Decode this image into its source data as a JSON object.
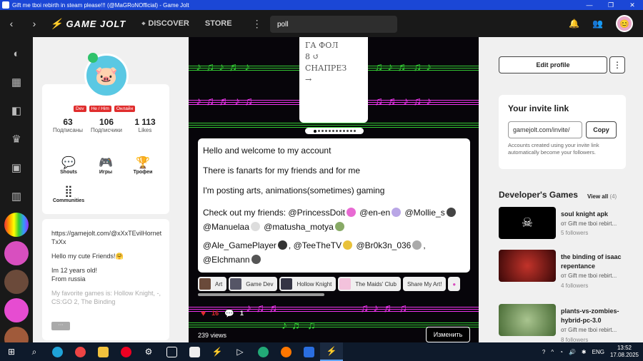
{
  "window": {
    "title": "Gift me tboi rebirth in steam please!!! (@MaGRoNOfficial) - Game Jolt",
    "minimize": "—",
    "maximize": "❐",
    "close": "✕"
  },
  "nav": {
    "back": "‹",
    "forward": "›",
    "logo": "GAME JOLT",
    "discover": "DISCOVER",
    "store": "STORE",
    "more": "⋮",
    "search_value": "poll"
  },
  "profile": {
    "tags": [
      "Dev",
      "He / Him",
      "Онлайн"
    ],
    "stats": [
      {
        "num": "63",
        "label": "Подписаны"
      },
      {
        "num": "106",
        "label": "Подписчики"
      },
      {
        "num": "1 113",
        "label": "Likes"
      }
    ],
    "tabs": [
      "Shouts",
      "Игры",
      "Трофеи",
      "Communities"
    ],
    "bio": {
      "link": "https://gamejolt.com/@xXxTEvilHornetTxXx",
      "greeting": "Hello my cute Friends!🤗",
      "age": "Im 12 years old!",
      "from": "From russia",
      "fav": "My favorite games is: Hollow Knight, -, CS:GO 2, The Binding",
      "more": "···"
    }
  },
  "post": {
    "sketch_text": "ГА ФОЛ\n8 ↺\nСНАПРЕЗ\n→",
    "lines": [
      "Hello and welcome to my account",
      "There is fanarts for my friends and for me",
      "I'm posting arts, animations(sometimes) gaming"
    ],
    "mentions_intro": "Check out my friends:",
    "mentions1": [
      "@PrincessDoit",
      "@en-en",
      "@Mollie_s",
      "@Manuelaa",
      "@matusha_motya"
    ],
    "mentions2": [
      "@Ale_GamePlayer",
      "@TeeTheTV",
      "@Br0k3n_036",
      "@Elchmann"
    ],
    "chips": [
      "Art",
      "Game Dev",
      "Hollow Knight",
      "The Maids' Club",
      "Share My Art!"
    ],
    "likes": "16",
    "comments": "1",
    "views": "239 views",
    "edit": "Изменить"
  },
  "right": {
    "edit_profile": "Edit profile",
    "kebab": "⋮",
    "invite_title": "Your invite link",
    "invite_value": "gamejolt.com/invite/",
    "copy": "Copy",
    "invite_note": "Accounts created using your invite link automatically become your followers.",
    "dev_games_title": "Developer's Games",
    "view_all": "View all",
    "view_all_count": "(4)",
    "games": [
      {
        "title": "soul knight apk",
        "by": "от Gift me tboi rebirt...",
        "followers": "5 followers",
        "color": "#000000"
      },
      {
        "title": "the binding of isaac repentance",
        "by": "от Gift me tboi rebirt...",
        "followers": "4 followers",
        "color": "#7a1010"
      },
      {
        "title": "plants-vs-zombies-hybrid-pc-3.0",
        "by": "от Gift me tboi rebirt...",
        "followers": "8 followers",
        "color": "#5e8a4a"
      }
    ]
  },
  "taskbar": {
    "lang": "ENG",
    "time": "13:52",
    "date": "17.08.2025"
  }
}
